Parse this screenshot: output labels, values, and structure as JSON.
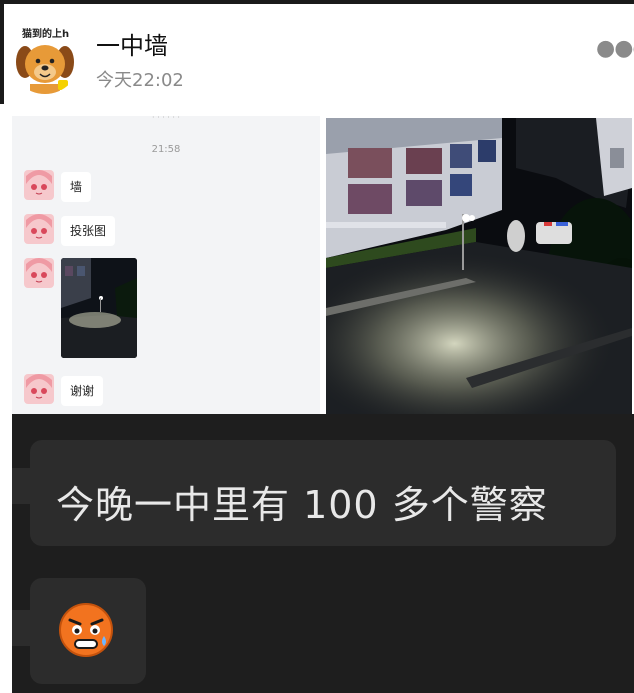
{
  "post": {
    "author": "一中墙",
    "time": "今天22:02",
    "more_icon": "more-dots-icon",
    "avatar_tag": "猫到的上h"
  },
  "chat_screenshot": {
    "time": "21:58",
    "messages": [
      {
        "type": "text",
        "text": "墙"
      },
      {
        "type": "text",
        "text": "投张图"
      },
      {
        "type": "image",
        "description_icon": "night-photo-thumbnail"
      },
      {
        "type": "text",
        "text": "谢谢"
      }
    ]
  },
  "dark_chat": {
    "message": "今晚一中里有 100 多个警察",
    "emoji_icon": "sweat-emoji-icon"
  },
  "colors": {
    "time_gray": "#8a8a8a",
    "dark_bg": "#1e1e1e",
    "bubble_dark": "#2c2c2c",
    "chat_bg": "#f3f4f6"
  }
}
